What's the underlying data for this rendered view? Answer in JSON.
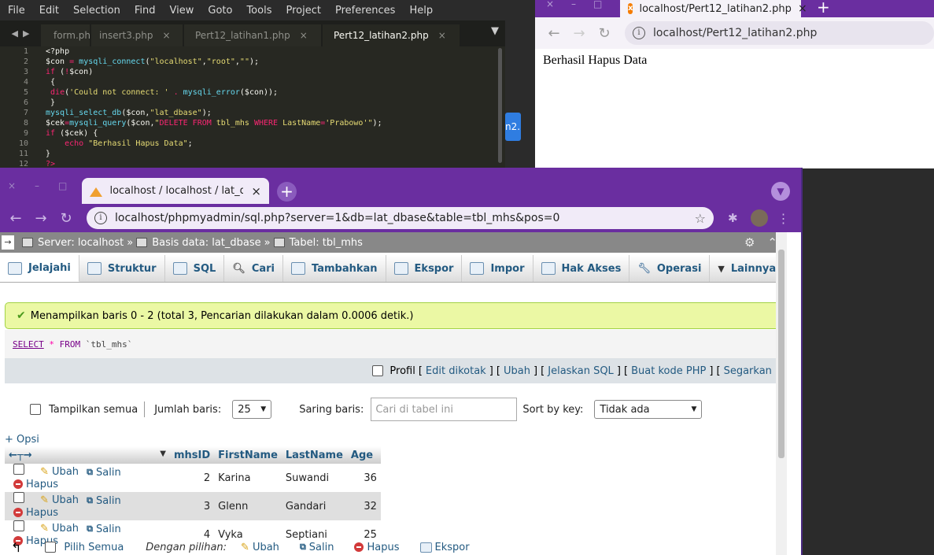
{
  "editor": {
    "menu": [
      "File",
      "Edit",
      "Selection",
      "Find",
      "View",
      "Goto",
      "Tools",
      "Project",
      "Preferences",
      "Help"
    ],
    "tabs": [
      {
        "label": "form.ph",
        "close": ""
      },
      {
        "label": "insert3.php",
        "close": "×"
      },
      {
        "label": "Pert12_latihan1.php",
        "close": "×"
      },
      {
        "label": "Pert12_latihan2.php",
        "close": "×"
      }
    ],
    "nav_left": "◀",
    "nav_right": "▶",
    "dropdown": "▼",
    "line_numbers": [
      "1",
      "2",
      "3",
      "4",
      "5",
      "6",
      "7",
      "8",
      "9",
      "10",
      "11",
      "12"
    ],
    "behind_button_text": "n2."
  },
  "small_browser": {
    "tab_title": "localhost/Pert12_latihan2.php",
    "tab_close": "×",
    "new_tab": "+",
    "url": "localhost/Pert12_latihan2.php",
    "content": "Berhasil Hapus Data"
  },
  "main_browser": {
    "tab_title": "localhost / localhost / lat_dba",
    "tab_close": "×",
    "new_tab": "+",
    "url": "localhost/phpmyadmin/sql.php?server=1&db=lat_dbase&table=tbl_mhs&pos=0"
  },
  "pma": {
    "breadcrumb": {
      "server": "Server: localhost",
      "sep1": "»",
      "database": "Basis data: lat_dbase",
      "sep2": "»",
      "table": "Tabel: tbl_mhs"
    },
    "tabs": [
      "Jelajahi",
      "Struktur",
      "SQL",
      "Cari",
      "Tambahkan",
      "Ekspor",
      "Impor",
      "Hak Akses",
      "Operasi",
      "Lainnya"
    ],
    "success_message": "Menampilkan baris 0 - 2 (total 3, Pencarian dilakukan dalam 0.0006 detik.)",
    "sql": {
      "select": "SELECT",
      "star": "*",
      "from": "FROM",
      "table": "`tbl_mhs`"
    },
    "sql_tools": {
      "profil": "Profil",
      "edit_inline": "Edit dikotak",
      "ubah": "Ubah",
      "jelaskan": "Jelaskan SQL",
      "buat_kode": "Buat kode PHP",
      "segarkan": "Segarkan"
    },
    "controls": {
      "show_all": "Tampilkan semua",
      "jumlah_baris_label": "Jumlah baris:",
      "jumlah_baris_value": "25",
      "saring_label": "Saring baris:",
      "saring_placeholder": "Cari di tabel ini",
      "sort_label": "Sort by key:",
      "sort_value": "Tidak ada"
    },
    "opsi": "+ Opsi",
    "columns": [
      "mhsID",
      "FirstName",
      "LastName",
      "Age"
    ],
    "actions": {
      "edit": "Ubah",
      "copy": "Salin",
      "delete": "Hapus"
    },
    "rows": [
      {
        "mhsID": "2",
        "FirstName": "Karina",
        "LastName": "Suwandi",
        "Age": "36"
      },
      {
        "mhsID": "3",
        "FirstName": "Glenn",
        "LastName": "Gandari",
        "Age": "32"
      },
      {
        "mhsID": "4",
        "FirstName": "Vyka",
        "LastName": "Septiani",
        "Age": "25"
      }
    ],
    "bottom": {
      "check_all": "Pilih Semua",
      "with_selected": "Dengan pilihan:",
      "edit": "Ubah",
      "copy": "Salin",
      "delete": "Hapus",
      "export": "Ekspor"
    }
  },
  "colors": {
    "browser_theme": "#6a2ea0",
    "editor_bg": "#272822",
    "success_bg": "#ebf8a4",
    "link": "#235a81"
  }
}
